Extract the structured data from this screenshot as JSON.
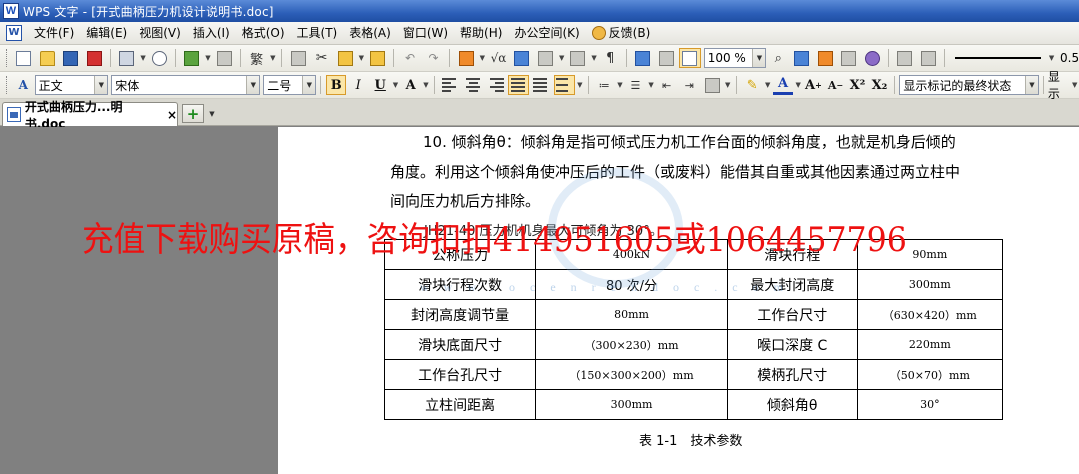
{
  "window": {
    "title": "WPS 文字 - [开式曲柄压力机设计说明书.doc]",
    "app_icon_letter": "W"
  },
  "menu": {
    "logo_letter": "W",
    "items": [
      "文件(F)",
      "编辑(E)",
      "视图(V)",
      "插入(I)",
      "格式(O)",
      "工具(T)",
      "表格(A)",
      "窗口(W)",
      "帮助(H)",
      "办公空间(K)"
    ],
    "feedback": "反馈(B)"
  },
  "toolbar": {
    "zoom": "100 %",
    "line_weight": "0.5",
    "icons": [
      "new-doc-icon",
      "open-folder-icon",
      "save-icon",
      "export-pdf-icon",
      "print-icon",
      "print-preview-icon",
      "mail-icon",
      "cut-icon",
      "copy-icon",
      "paste-icon",
      "format-painter-icon",
      "undo-icon",
      "redo-icon",
      "table-icon",
      "formula-icon",
      "hyperlink-icon",
      "columns-icon",
      "trace-icon",
      "help-icon"
    ]
  },
  "format_bar": {
    "style": "正文",
    "font": "宋体",
    "size": "二号",
    "bold": "B",
    "italic": "I",
    "underline": "U",
    "font_color": "A",
    "grow": "A",
    "shrink": "A",
    "superscript": "X²",
    "subscript": "X₂",
    "track_state": "显示标记的最终状态",
    "show": "显示"
  },
  "tabs": {
    "active": "开式曲柄压力...明书.doc",
    "close": "×",
    "new": "+"
  },
  "document": {
    "para_line1": "10. 倾斜角θ：倾斜角是指可倾式压力机工作台面的倾斜角度，也就是机身后倾的",
    "para_line2": "角度。利用这个倾斜角使冲压后的工件（或废料）能借其自重或其他因素通过两立柱中",
    "para_line3": "间向压力机后方排除。",
    "caption_top": "JH21-40 压力机机身最大可倾角为 30°。",
    "table_rows": [
      [
        "公称压力",
        "400kN",
        "滑块行程",
        "90mm"
      ],
      [
        "滑块行程次数",
        "80 次/分",
        "最大封闭高度",
        "300mm"
      ],
      [
        "封闭高度调节量",
        "80mm",
        "工作台尺寸",
        "（630×420）mm"
      ],
      [
        "滑块底面尺寸",
        "（300×230）mm",
        "喉口深度 C",
        "220mm"
      ],
      [
        "工作台孔尺寸",
        "（150×300×200）mm",
        "模柄孔尺寸",
        "（50×70）mm"
      ],
      [
        "立柱间距离",
        "300mm",
        "倾斜角θ",
        "30°"
      ]
    ],
    "table_caption": "表 1-1　技术参数"
  },
  "overlay": {
    "ad_text": "充值下载购买原稿，咨询扣扣414951605或1064457796",
    "watermark_url": "w w w . o c e n r e n d o c . c o m"
  },
  "colors": {
    "overlay_red": "#ee1111",
    "titlebar_blue": "#2c5fb8",
    "highlight": "#fbe6a8"
  }
}
